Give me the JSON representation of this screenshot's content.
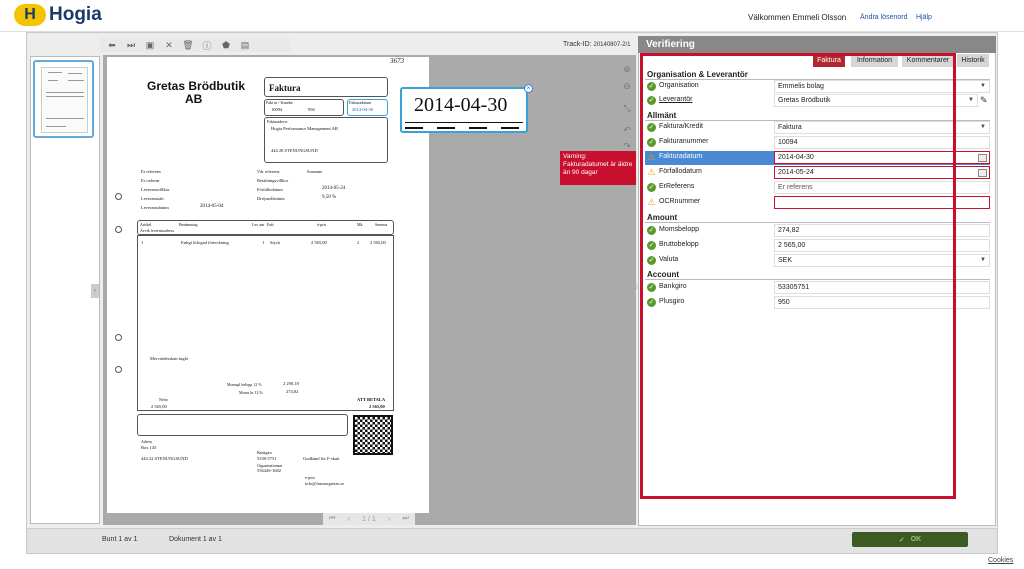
{
  "header": {
    "logo_letter": "H",
    "brand": "Hogia",
    "welcome": "Välkommen Emmeli Olsson",
    "change_password": "Ändra lösenord",
    "help": "Hjälp"
  },
  "toolbar": {
    "icons": [
      "arrow-left-icon",
      "skip-end-icon",
      "save-icon",
      "close-icon",
      "trash-icon",
      "info-icon",
      "stamp-icon",
      "inbox-icon"
    ],
    "glyphs": [
      "⬅",
      "⏭",
      "▣",
      "✕",
      "🗑",
      "ⓘ",
      "⬟",
      "▤"
    ],
    "track_label": "Track-ID:",
    "track_value": "20140807-2/1"
  },
  "viewer": {
    "pager_current": "1 / 1",
    "zoom_value": "2014-04-30",
    "doc": {
      "handwritten": "3673",
      "seller_name_line1": "Gretas Brödbutik",
      "seller_name_line2": "AB",
      "doc_type": "Faktura",
      "fakt_nr_label": "Fakt nr / Kundnr",
      "fakt_nr": "10094",
      "kund_nr": "956",
      "fakturadatum_label": "Fakturadatum",
      "fakturadatum": "2014-04-30",
      "buyer_label": "Fakturadress",
      "buyer_name": "Hogia Performance Management AB",
      "buyer_city": "444 28  STENUNGSUND",
      "er_ref": "Er referens",
      "er_ordernr": "Er ordernr",
      "leveransvillkor": "Leveransvillkor",
      "leveranssatt": "Leveranssätt",
      "leveransdatum": "Leveransdatum",
      "leveransdatum_val": "2014-05-04",
      "var_ref": "Vår referens",
      "var_ref_val": "Susanne",
      "betalningsvillkor": "Betalningsvillkor",
      "forfallodatum": "Förfallodatum",
      "forfallodatum_val": "2014-05-24",
      "drojsmalsranta": "Dröjsmålsränta",
      "drojsmalsranta_val": "9,50 %",
      "col_artikel": "Artikel",
      "col_benamning": "Benämning",
      "col_levant": "Lev ant",
      "col_enh": "Enh",
      "col_apris": "á-pris",
      "col_moms": "Mk",
      "col_summa": "Summa",
      "avvik": "Avvik leveransadress",
      "line_nr": "1",
      "line_desc": "Enligt bifogad förteckning",
      "line_qty": "1",
      "line_unit": "Styck",
      "line_price": "2 565,00",
      "line_mk": "2",
      "line_sum": "2 565,00",
      "moms_note": "Mervärdesskatt ingår",
      "momsfritt_label": "Momspl belopp 12 %",
      "momsfritt_val": "2 290,18",
      "moms_label": "Moms kr 12 %",
      "moms_val": "274,82",
      "netto_label": "Netto",
      "netto_val": "2 565,00",
      "att_betala_label": "ATT BETALA",
      "att_betala_val": "2 565,00",
      "adress_label": "Adress",
      "adress_box": "Box 145",
      "adress_city": "444 22  STENUNGSUND",
      "bankgiro_label": "Bankgiro",
      "bankgiro_val": "5330-5751",
      "orgnr_label": "Organisationsnr",
      "orgnr_val": "556426-1682",
      "fskatt": "Godkänd för F-skatt",
      "epost_label": "e-post",
      "epost_val": "info@farmorgretas.se"
    }
  },
  "panel": {
    "title": "Verifiering",
    "tabs": [
      "Faktura",
      "Information",
      "Kommentarer",
      "Historik"
    ],
    "sections": {
      "org": "Organisation & Leverantör",
      "allmant": "Allmänt",
      "amount": "Amount",
      "account": "Account"
    },
    "fields": {
      "organisation_label": "Organisation",
      "organisation_value": "Emmelis bolag",
      "leverantor_label": "Leverantör",
      "leverantor_value": "Gretas Brödbutik",
      "faktura_kredit_label": "Faktura/Kredit",
      "faktura_kredit_value": "Faktura",
      "fakturanummer_label": "Fakturanummer",
      "fakturanummer_value": "10094",
      "fakturadatum_label": "Fakturadatum",
      "fakturadatum_value": "2014-04-30",
      "forfallodatum_label": "Förfallodatum",
      "forfallodatum_value": "2014-05-24",
      "erreferens_label": "ErReferens",
      "erreferens_placeholder": "Er referens",
      "ocr_label": "OCRnummer",
      "ocr_value": "",
      "momsbelopp_label": "Momsbelopp",
      "momsbelopp_value": "274,82",
      "bruttobelopp_label": "Bruttobelopp",
      "bruttobelopp_value": "2 565,00",
      "valuta_label": "Valuta",
      "valuta_value": "SEK",
      "bankgiro_label": "Bankgiro",
      "bankgiro_value": "53305751",
      "plusgiro_label": "Plusgiro",
      "plusgiro_value": "950"
    },
    "warning": "Varning: Fakturadatumet är äldre än 90 dagar"
  },
  "footer": {
    "bunt": "Bunt 1 av 1",
    "dokument": "Dokument 1 av 1",
    "ok": "OK",
    "ok_glyph": "✓",
    "cookies": "Cookies"
  },
  "colors": {
    "accent_red": "#c8102e",
    "highlight_blue": "#4a8ad4",
    "ok_green": "#3c5a24",
    "brand_yellow": "#f4c400"
  }
}
